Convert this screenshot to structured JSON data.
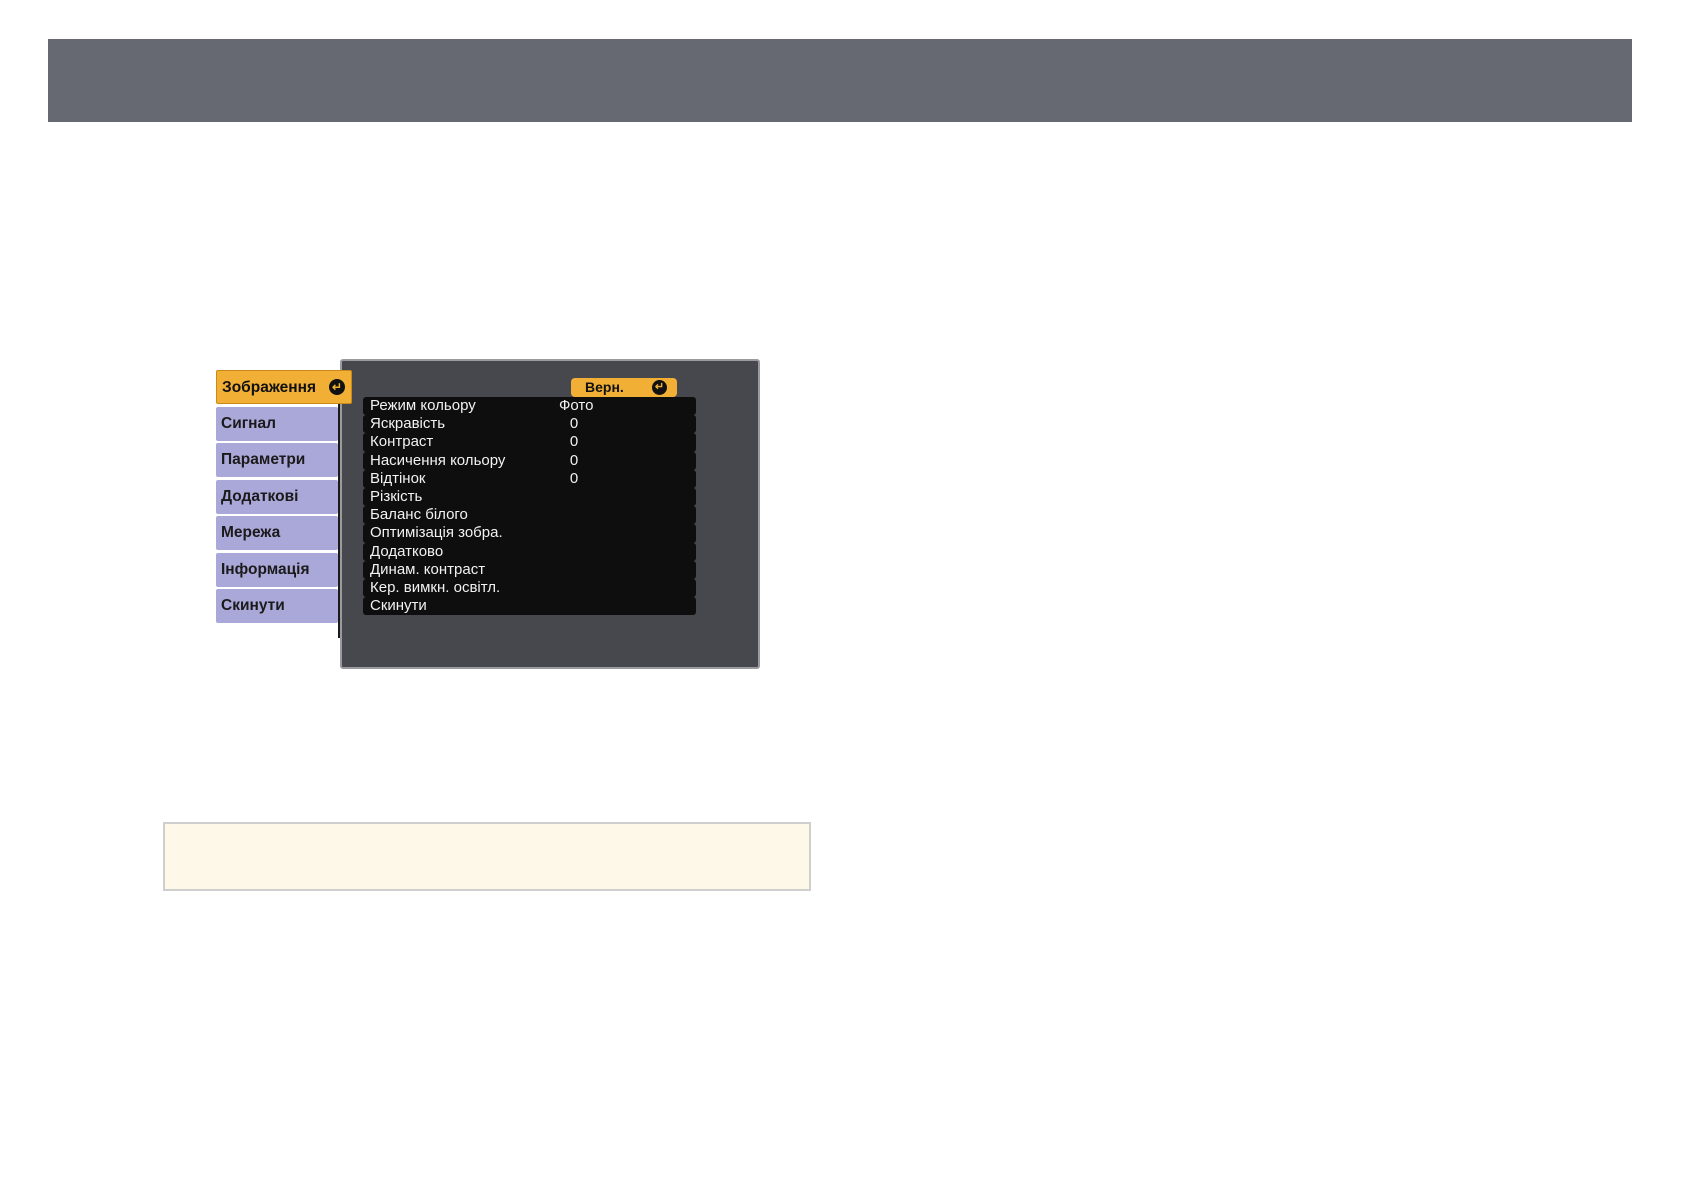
{
  "osd": {
    "tabs": [
      {
        "label": "Зображення",
        "active": true
      },
      {
        "label": "Сигнал"
      },
      {
        "label": "Параметри"
      },
      {
        "label": "Додаткові"
      },
      {
        "label": "Мережа"
      },
      {
        "label": "Інформація"
      },
      {
        "label": "Скинути"
      }
    ],
    "back_label": "Верн.",
    "items": [
      {
        "label": "Режим кольору",
        "value": "Фото"
      },
      {
        "label": "Яскравість",
        "value": "0"
      },
      {
        "label": "Контраст",
        "value": "0"
      },
      {
        "label": "Насичення кольору",
        "value": "0"
      },
      {
        "label": "Відтінок",
        "value": "0"
      },
      {
        "label": "Різкість",
        "value": ""
      },
      {
        "label": "Баланс білого",
        "value": ""
      },
      {
        "label": "Оптимізація зобра.",
        "value": ""
      },
      {
        "label": "Додатково",
        "value": ""
      },
      {
        "label": "Динам. контраст",
        "value": ""
      },
      {
        "label": "Кер. вимкн. освітл.",
        "value": ""
      },
      {
        "label": "Скинути",
        "value": ""
      }
    ],
    "colors": {
      "active_tab": "#f1b035",
      "tab": "#a9a8d9",
      "panel": "#47484d",
      "item_bg": "#0e0e0e"
    }
  }
}
